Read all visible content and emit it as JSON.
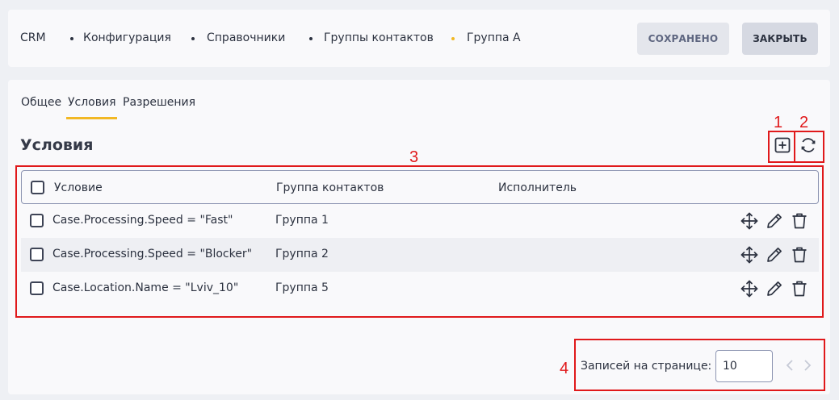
{
  "breadcrumb": {
    "items": [
      "CRM",
      "Конфигурация",
      "Справочники",
      "Группы контактов",
      "Группа А"
    ]
  },
  "header": {
    "saved_label": "СОХРАНЕНО",
    "close_label": "ЗАКРЫТЬ"
  },
  "tabs": [
    {
      "label": "Общее",
      "active": false
    },
    {
      "label": "Условия",
      "active": true
    },
    {
      "label": "Разрешения",
      "active": false
    }
  ],
  "section": {
    "title": "Условия",
    "add_icon": "plus-square-icon",
    "refresh_icon": "refresh-icon"
  },
  "table": {
    "columns": [
      "Условие",
      "Группа контактов",
      "Исполнитель"
    ],
    "rows": [
      {
        "condition": "Case.Processing.Speed = \"Fast\"",
        "group": "Группа 1",
        "executor": ""
      },
      {
        "condition": "Case.Processing.Speed = \"Blocker\"",
        "group": "Группа 2",
        "executor": ""
      },
      {
        "condition": "Case.Location.Name = \"Lviv_10\"",
        "group": "Группа 5",
        "executor": ""
      }
    ],
    "row_icons": [
      "move-icon",
      "edit-icon",
      "delete-icon"
    ]
  },
  "pager": {
    "label": "Записей на странице:",
    "page_size": "10"
  },
  "annotations": [
    "1",
    "2",
    "3",
    "4"
  ],
  "colors": {
    "accent": "#f2b824",
    "annotation": "#e0191b",
    "text": "#2c3240"
  }
}
